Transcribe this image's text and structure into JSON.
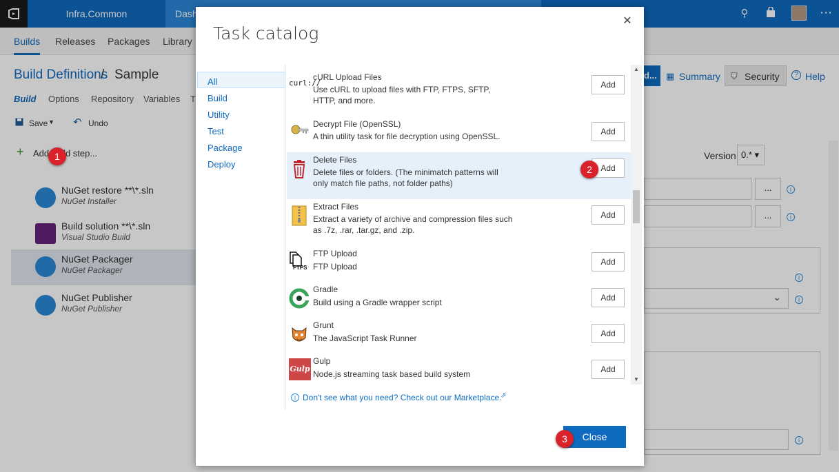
{
  "topbar": {
    "project": "Infra.Common",
    "dashboard": "Dash"
  },
  "hubs": [
    "Builds",
    "Releases",
    "Packages",
    "Library"
  ],
  "breadcrumb": {
    "parent": "Build Definitions",
    "sep": "/",
    "current": "Sample"
  },
  "build_tabs": [
    "Build",
    "Options",
    "Repository",
    "Variables",
    "T"
  ],
  "toolbar": {
    "save": "Save",
    "undo": "Undo"
  },
  "add_step": "Add build step...",
  "steps": [
    {
      "name": "NuGet restore **\\*.sln",
      "sub": "NuGet Installer"
    },
    {
      "name": "Build solution **\\*.sln",
      "sub": "Visual Studio Build"
    },
    {
      "name": "NuGet Packager",
      "sub": "NuGet Packager"
    },
    {
      "name": "NuGet Publisher",
      "sub": "NuGet Publisher"
    }
  ],
  "right_actions": {
    "queue": "d...",
    "summary": "Summary",
    "security": "Security",
    "help": "Help"
  },
  "version": {
    "label": "Version",
    "value": "0.*"
  },
  "ellipsis": "...",
  "dialog": {
    "title": "Task catalog",
    "categories": [
      "All",
      "Build",
      "Utility",
      "Test",
      "Package",
      "Deploy"
    ],
    "tasks": [
      {
        "name": "cURL Upload Files",
        "desc": "Use cURL to upload files with FTP, FTPS, SFTP, HTTP, and more.",
        "icon": "curl-icon"
      },
      {
        "name": "Decrypt File (OpenSSL)",
        "desc": "A thin utility task for file decryption using OpenSSL.",
        "icon": "key-icon"
      },
      {
        "name": "Delete Files",
        "desc": "Delete files or folders. (The minimatch patterns will only match file paths, not folder paths)",
        "icon": "trash-icon"
      },
      {
        "name": "Extract Files",
        "desc": "Extract a variety of archive and compression files such as .7z, .rar, .tar.gz, and .zip.",
        "icon": "zip-icon"
      },
      {
        "name": "FTP Upload",
        "desc": "FTP Upload",
        "icon": "ftps-icon"
      },
      {
        "name": "Gradle",
        "desc": "Build using a Gradle wrapper script",
        "icon": "gradle-icon"
      },
      {
        "name": "Grunt",
        "desc": "The JavaScript Task Runner",
        "icon": "grunt-icon"
      },
      {
        "name": "Gulp",
        "desc": "Node.js streaming task based build system",
        "icon": "gulp-icon"
      }
    ],
    "add_label": "Add",
    "marketplace": "Don't see what you need? Check out our Marketplace.",
    "close": "Close",
    "curl_text": "curl://",
    "ftps_text": "FTPS",
    "gulp_text": "Gulp"
  },
  "badges": [
    "1",
    "2",
    "3"
  ]
}
